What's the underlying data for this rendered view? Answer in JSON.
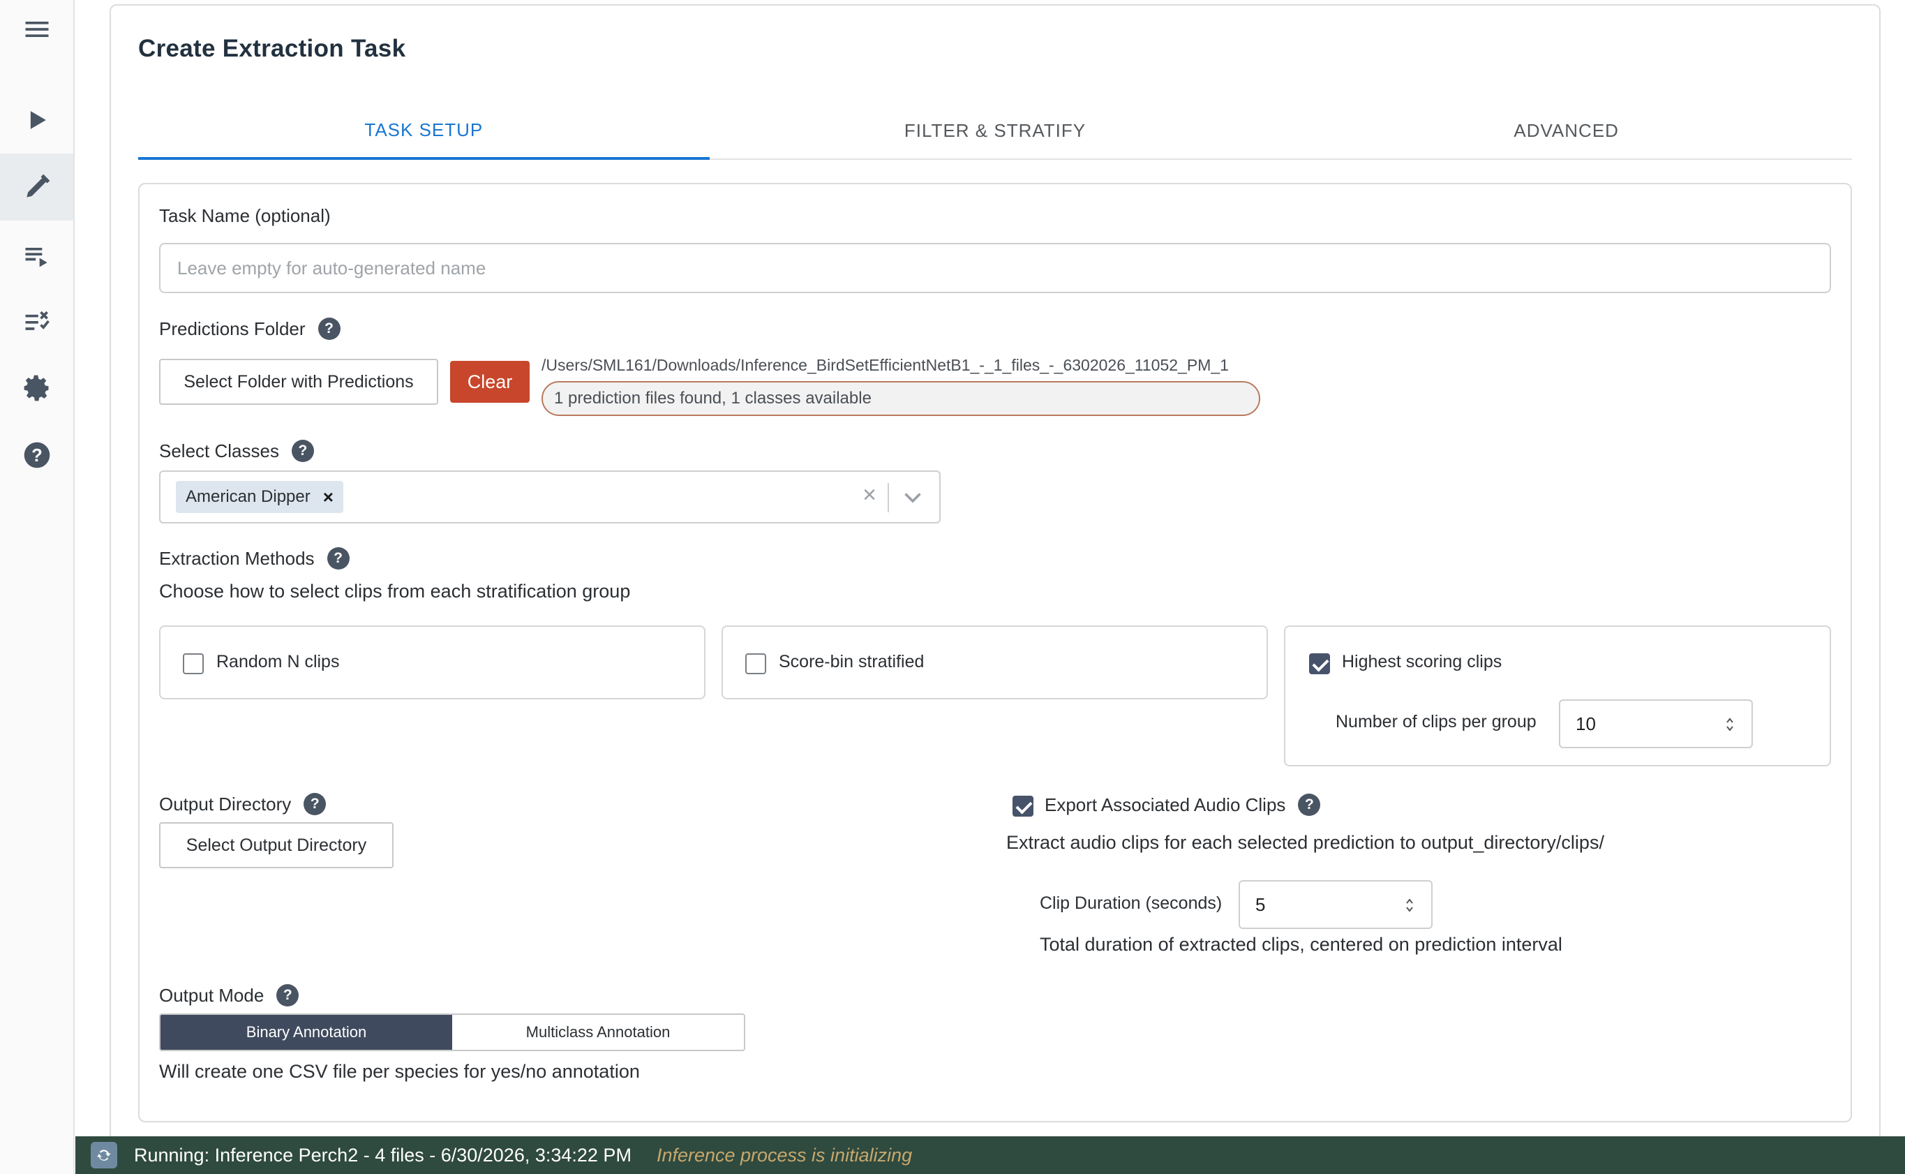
{
  "page": {
    "title": "Create Extraction Task"
  },
  "tabs": [
    {
      "label": "TASK SETUP",
      "active": true
    },
    {
      "label": "FILTER & STRATIFY",
      "active": false
    },
    {
      "label": "ADVANCED",
      "active": false
    }
  ],
  "sidebar": {
    "items": [
      {
        "icon": "menu-icon"
      },
      {
        "icon": "play-icon"
      },
      {
        "icon": "pencil-icon",
        "active": true
      },
      {
        "icon": "playlist-play-icon"
      },
      {
        "icon": "list-check-icon"
      },
      {
        "icon": "gear-icon"
      },
      {
        "icon": "help-icon"
      }
    ]
  },
  "form": {
    "task_name": {
      "label": "Task Name (optional)",
      "placeholder": "Leave empty for auto-generated name",
      "value": ""
    },
    "predictions": {
      "label": "Predictions Folder",
      "select_button": "Select Folder with Predictions",
      "clear_button": "Clear",
      "path": "/Users/SML161/Downloads/Inference_BirdSetEfficientNetB1_-_1_files_-_6302026_11052_PM_1",
      "status": "1 prediction files found, 1 classes available"
    },
    "classes": {
      "label": "Select Classes",
      "selected": [
        "American Dipper"
      ],
      "chip_remove": "×",
      "clear_all": "×"
    },
    "methods": {
      "label": "Extraction Methods",
      "description": "Choose how to select clips from each stratification group",
      "options": [
        {
          "label": "Random N clips",
          "checked": false
        },
        {
          "label": "Score-bin stratified",
          "checked": false
        },
        {
          "label": "Highest scoring clips",
          "checked": true
        }
      ],
      "clips_per_group_label": "Number of clips per group",
      "clips_per_group_value": "10"
    },
    "output_dir": {
      "label": "Output Directory",
      "button": "Select Output Directory"
    },
    "export_audio": {
      "label": "Export Associated Audio Clips",
      "checked": true,
      "description": "Extract audio clips for each selected prediction to output_directory/clips/",
      "duration_label": "Clip Duration (seconds)",
      "duration_value": "5",
      "duration_hint": "Total duration of extracted clips, centered on prediction interval"
    },
    "output_mode": {
      "label": "Output Mode",
      "options": [
        "Binary Annotation",
        "Multiclass Annotation"
      ],
      "selected": "Binary Annotation",
      "description": "Will create one CSV file per species for yes/no annotation"
    },
    "help_glyph": "?"
  },
  "status_bar": {
    "text": "Running: Inference Perch2 - 4 files - 6/30/2026, 3:34:22 PM",
    "substatus": "Inference process is initializing"
  },
  "colors": {
    "accent": "#1976d2",
    "clear_button": "#c8462b",
    "status_bar_bg": "#2f4a3f",
    "status_sub": "#c7a86d",
    "segment_active": "#3f4a5e"
  }
}
